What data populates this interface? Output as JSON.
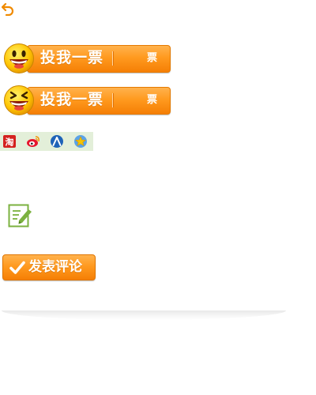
{
  "toolbar": {
    "back_icon": "back-arrow-icon",
    "accent_color": "#ff9a1f"
  },
  "vote_buttons": [
    {
      "label": "投我一票",
      "count_label": "票",
      "face_icon": "smiley-happy-icon"
    },
    {
      "label": "投我一票",
      "count_label": "票",
      "face_icon": "smiley-laughing-icon"
    }
  ],
  "share": {
    "items": [
      {
        "icon": "taobao-icon",
        "color": "#d4211f"
      },
      {
        "icon": "weibo-icon",
        "color": "#e6162d"
      },
      {
        "icon": "renren-icon",
        "color": "#1e63b8"
      },
      {
        "icon": "qzone-icon",
        "color": "#f4b400"
      }
    ]
  },
  "note": {
    "icon": "note-edit-icon",
    "color": "#7bb13f"
  },
  "comment": {
    "submit_label": "发表评论",
    "check_icon": "check-icon"
  }
}
